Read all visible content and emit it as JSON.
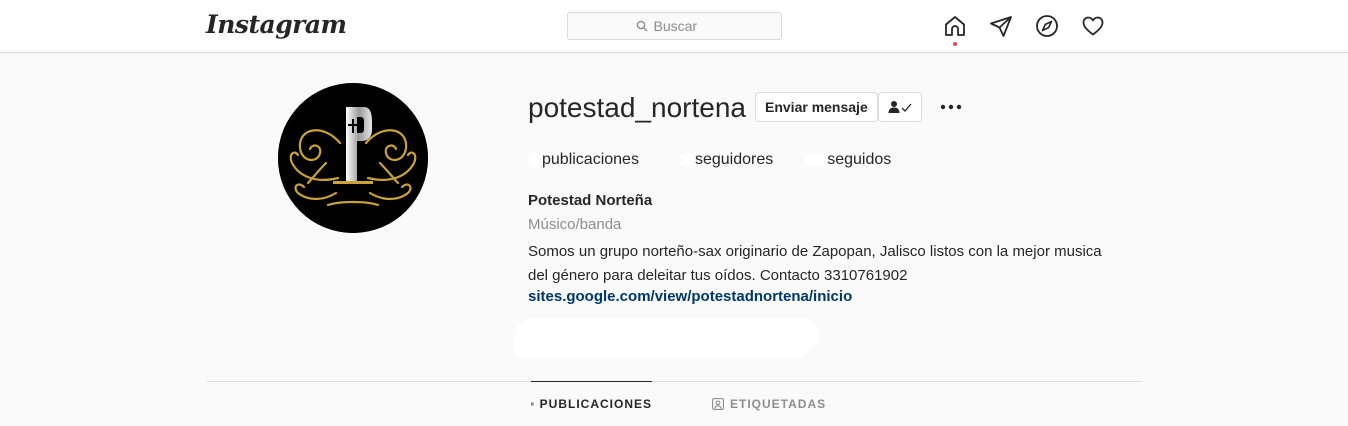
{
  "nav": {
    "logo": "Instagram",
    "search": {
      "placeholder": "Buscar"
    },
    "icons": [
      "home-icon",
      "direct-message-icon",
      "explore-icon",
      "activity-heart-icon"
    ]
  },
  "profile": {
    "username": "potestad_nortena",
    "message_button": "Enviar mensaje",
    "stats": {
      "posts_label": "publicaciones",
      "followers_label": "seguidores",
      "following_label": "seguidos"
    },
    "full_name": "Potestad Norteña",
    "category": "Músico/banda",
    "bio_line1": "Somos un grupo norteño-sax originario de Zapopan, Jalisco listos con la mejor musica",
    "bio_line2": "del género para deleitar tus oídos. Contacto 3310761902",
    "link": "sites.google.com/view/potestadnortena/inicio"
  },
  "tabs": {
    "posts": "PUBLICACIONES",
    "tagged": "ETIQUETADAS"
  },
  "colors": {
    "link": "#00376b",
    "notification_dot": "#ed4956",
    "avatar_gold": "#c9a23a"
  }
}
